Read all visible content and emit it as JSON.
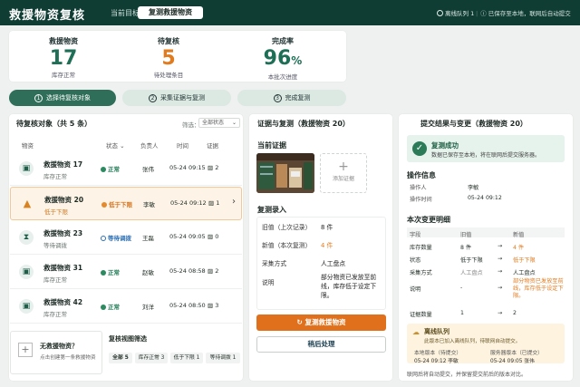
{
  "header": {
    "app_title": "救援物资复核",
    "goal_label": "当前目标：",
    "goal_value": "复测救援物资",
    "offline_label": "离线队列",
    "offline_count": "1",
    "saved_text": "已保存至本地，联网后自动提交"
  },
  "stats": [
    {
      "label": "救援物资",
      "value": "17",
      "sub": "库存正常"
    },
    {
      "label": "待复核",
      "value": "5",
      "sub": "待处理条目"
    },
    {
      "label": "完成率",
      "value": "96",
      "unit": "%",
      "sub": "本批次进度"
    }
  ],
  "steps": [
    {
      "num": "1",
      "label": "选择待复核对象"
    },
    {
      "num": "2",
      "label": "采集证据与复测"
    },
    {
      "num": "3",
      "label": "完成复测"
    }
  ],
  "list": {
    "title": "待复核对象（共 5 条）",
    "filter_label": "筛选：",
    "filter_value": "全部状态",
    "columns": {
      "item": "物资",
      "status": "状态",
      "person": "负责人",
      "time": "时间",
      "evidence": "证据"
    },
    "rows": [
      {
        "name": "救援物资 17",
        "sub": "库存正常",
        "status": "正常",
        "person": "张伟",
        "time": "05-24 09:15",
        "evidence": "2"
      },
      {
        "name": "救援物资 20",
        "sub": "低于下限",
        "status": "低于下限",
        "person": "李敏",
        "time": "05-24 09:12",
        "evidence": "1"
      },
      {
        "name": "救援物资 23",
        "sub": "等待调拨",
        "status": "等待调拨",
        "person": "王磊",
        "time": "05-24 09:05",
        "evidence": "0"
      },
      {
        "name": "救援物资 31",
        "sub": "库存正常",
        "status": "正常",
        "person": "赵敏",
        "time": "05-24 08:58",
        "evidence": "2"
      },
      {
        "name": "救援物资 42",
        "sub": "库存正常",
        "status": "正常",
        "person": "刘洋",
        "time": "05-24 08:50",
        "evidence": "3"
      }
    ],
    "empty": {
      "title": "无救援物资？",
      "desc": "点击创建第一条救援物资"
    },
    "view_filter_title": "复核视图筛选",
    "chips": [
      "全部 5",
      "库存正常 3",
      "低于下限 1",
      "等待调拨 1"
    ]
  },
  "evidence": {
    "title": "证据与复测（救援物资 20）",
    "current_label": "当前证据",
    "add_label": "添加证据",
    "retest_label": "复测录入",
    "fields": [
      {
        "label": "旧值（上次记录）",
        "value": "8 件"
      },
      {
        "label": "新值（本次复测）",
        "value": "4 件"
      },
      {
        "label": "采集方式",
        "value": "人工盘点"
      },
      {
        "label": "说明",
        "value": "部分物资已发放至前线，库存低于设定下限。"
      }
    ],
    "primary_button": "复测救援物资",
    "secondary_button": "稍后处理"
  },
  "result": {
    "title": "提交结果与变更（救援物资 20）",
    "success_title": "复测成功",
    "success_desc": "数据已保存至本地，将在联网后提交服务器。",
    "op_title": "操作信息",
    "op": [
      {
        "label": "操作人",
        "value": "李敏"
      },
      {
        "label": "操作时间",
        "value": "05-24 09:12"
      }
    ],
    "change_title": "本次变更明细",
    "change_headers": [
      "字段",
      "旧值",
      "",
      "新值"
    ],
    "change_rows": [
      {
        "field": "库存数量",
        "old": "8 件",
        "arrow": "→",
        "new": "4 件"
      },
      {
        "field": "状态",
        "old": "低于下限",
        "arrow": "→",
        "new": "低于下限"
      },
      {
        "field": "采集方式",
        "old": "人工盘点",
        "arrow": "→",
        "new": "人工盘点"
      },
      {
        "field": "说明",
        "old": "-",
        "arrow": "→",
        "new": "部分物资已发放至前线，库存低于设定下限。"
      },
      {
        "field": "证据数量",
        "old": "1",
        "arrow": "→",
        "new": "2"
      }
    ],
    "queue_title": "离线队列",
    "queue_desc": "此版本已加入离线队列，待联网自动提交。",
    "queue_cols": [
      "本地版本（待提交）",
      "服务器版本（已提交）"
    ],
    "queue_vals": [
      "05-24 09:12  李敏",
      "05-24 09:05  张伟"
    ],
    "footnote": "联网后将自动提交，并保留提交前后的版本对比。"
  }
}
